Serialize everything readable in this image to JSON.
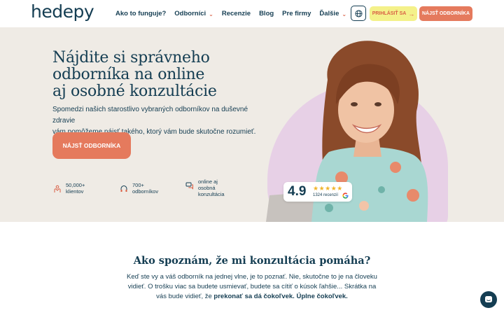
{
  "nav": {
    "logo": "hedepy",
    "items": [
      {
        "label": "Ako to funguje?",
        "dropdown": false
      },
      {
        "label": "Odborníci",
        "dropdown": true
      },
      {
        "label": "Recenzie",
        "dropdown": false
      },
      {
        "label": "Blog",
        "dropdown": false
      },
      {
        "label": "Pre firmy",
        "dropdown": false
      },
      {
        "label": "Ďalšie",
        "dropdown": true
      }
    ],
    "language_icon": "globe-icon",
    "login_label": "PRIHLÁSIŤ SA",
    "find_label": "NÁJSŤ ODBORNÍKA"
  },
  "hero": {
    "title_lines": [
      "Nájdite si správneho",
      "odborníka na online",
      "aj osobné konzultácie"
    ],
    "subtitle_lines": [
      "Spomedzi našich starostlivo vybraných odborníkov na duševné zdravie",
      "vám pomôžeme nájsť takého, ktorý vám bude skutočne rozumieť."
    ],
    "cta_label": "NÁJSŤ ODBORNÍKA",
    "stats": [
      {
        "icon": "people-hand-icon",
        "lines": [
          "50,000+",
          "klientov"
        ]
      },
      {
        "icon": "headset-icon",
        "lines": [
          "700+",
          "odborníkov"
        ]
      },
      {
        "icon": "chat-bubbles-icon",
        "lines": [
          "online aj",
          "osobná",
          "konzultácia"
        ]
      }
    ],
    "rating": {
      "value": "4.9",
      "stars": "★★★★★",
      "reviews": "1324 recenzií",
      "source_icon": "google-icon"
    }
  },
  "section2": {
    "title": "Ako spoznám, že mi konzultácia pomáha?",
    "body_plain": "Keď ste vy a váš odborník na jednej vlne, je to poznať. Nie, skutočne to je na človeku vidieť. O trošku viac sa budete usmievať, budete sa cítiť o kúsok ľahšie... Skrátka na vás bude vidieť, že ",
    "body_bold": "prekonať sa dá čokoľvek. Úplne čokoľvek."
  },
  "chat_widget": {
    "icon": "chat-icon"
  },
  "colors": {
    "primary_text": "#143d52",
    "accent_orange": "#e57a5d",
    "login_yellow": "#f4f18a",
    "hero_bg": "#efebe5",
    "blob_pink": "#e7d0e6",
    "star_gold": "#f0b429"
  }
}
